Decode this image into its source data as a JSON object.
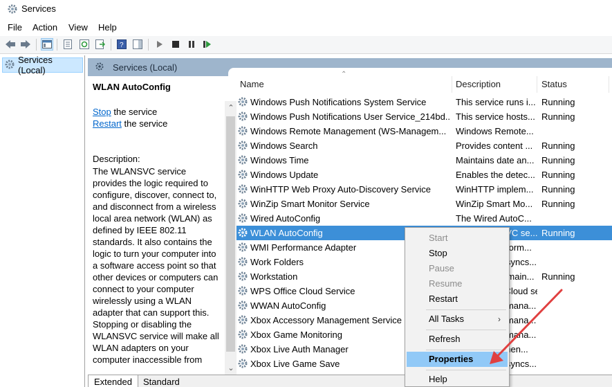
{
  "window": {
    "title": "Services"
  },
  "menu": [
    "File",
    "Action",
    "View",
    "Help"
  ],
  "tree": {
    "root_label": "Services (Local)"
  },
  "main_header": {
    "title": "Services (Local)"
  },
  "extended": {
    "service_name": "WLAN AutoConfig",
    "stop_link": "Stop",
    "stop_suffix": " the service",
    "restart_link": "Restart",
    "restart_suffix": " the service",
    "description_label": "Description:",
    "description_text": "The WLANSVC service provides the logic required to configure, discover, connect to, and disconnect from a wireless local area network (WLAN) as defined by IEEE 802.11 standards. It also contains the logic to turn your computer into a software access point so that other devices or computers can connect to your computer wirelessly using a WLAN adapter that can support this. Stopping or disabling the WLANSVC service will make all WLAN adapters on your computer inaccessible from"
  },
  "columns": {
    "name": "Name",
    "description": "Description",
    "status": "Status"
  },
  "rows": [
    {
      "name": "Windows Push Notifications System Service",
      "desc": "This service runs i...",
      "status": "Running"
    },
    {
      "name": "Windows Push Notifications User Service_214bd...",
      "desc": "This service hosts...",
      "status": "Running"
    },
    {
      "name": "Windows Remote Management (WS-Managem...",
      "desc": "Windows Remote...",
      "status": ""
    },
    {
      "name": "Windows Search",
      "desc": "Provides content ...",
      "status": "Running"
    },
    {
      "name": "Windows Time",
      "desc": "Maintains date an...",
      "status": "Running"
    },
    {
      "name": "Windows Update",
      "desc": "Enables the detec...",
      "status": "Running"
    },
    {
      "name": "WinHTTP Web Proxy Auto-Discovery Service",
      "desc": "WinHTTP implem...",
      "status": "Running"
    },
    {
      "name": "WinZip Smart Monitor Service",
      "desc": "WinZip Smart Mo...",
      "status": "Running"
    },
    {
      "name": "Wired AutoConfig",
      "desc": "The Wired AutoC...",
      "status": ""
    },
    {
      "name": "WLAN AutoConfig",
      "desc": "The WLANSVC se...",
      "status": "Running",
      "selected": true
    },
    {
      "name": "WMI Performance Adapter",
      "desc": "Provides perform...",
      "status": ""
    },
    {
      "name": "Work Folders",
      "desc": "This service syncs...",
      "status": ""
    },
    {
      "name": "Workstation",
      "desc": "Creates and main...",
      "status": "Running"
    },
    {
      "name": "WPS Office Cloud Service",
      "desc": "WPS Office Cloud service",
      "status": ""
    },
    {
      "name": "WWAN AutoConfig",
      "desc": "This service mana...",
      "status": ""
    },
    {
      "name": "Xbox Accessory Management Service",
      "desc": "This service mana...",
      "status": ""
    },
    {
      "name": "Xbox Game Monitoring",
      "desc": "This service mana...",
      "status": ""
    },
    {
      "name": "Xbox Live Auth Manager",
      "desc": "Provides authen...",
      "status": ""
    },
    {
      "name": "Xbox Live Game Save",
      "desc": "This service syncs...",
      "status": ""
    }
  ],
  "context_menu": {
    "start": "Start",
    "stop": "Stop",
    "pause": "Pause",
    "resume": "Resume",
    "restart": "Restart",
    "all_tasks": "All Tasks",
    "refresh": "Refresh",
    "properties": "Properties",
    "help": "Help"
  },
  "tabs": {
    "extended": "Extended",
    "standard": "Standard"
  },
  "colors": {
    "selection": "#3c8fd8",
    "header": "#9eb5cc",
    "arrow": "#e04040",
    "menu_highlight": "#91c9f7"
  }
}
